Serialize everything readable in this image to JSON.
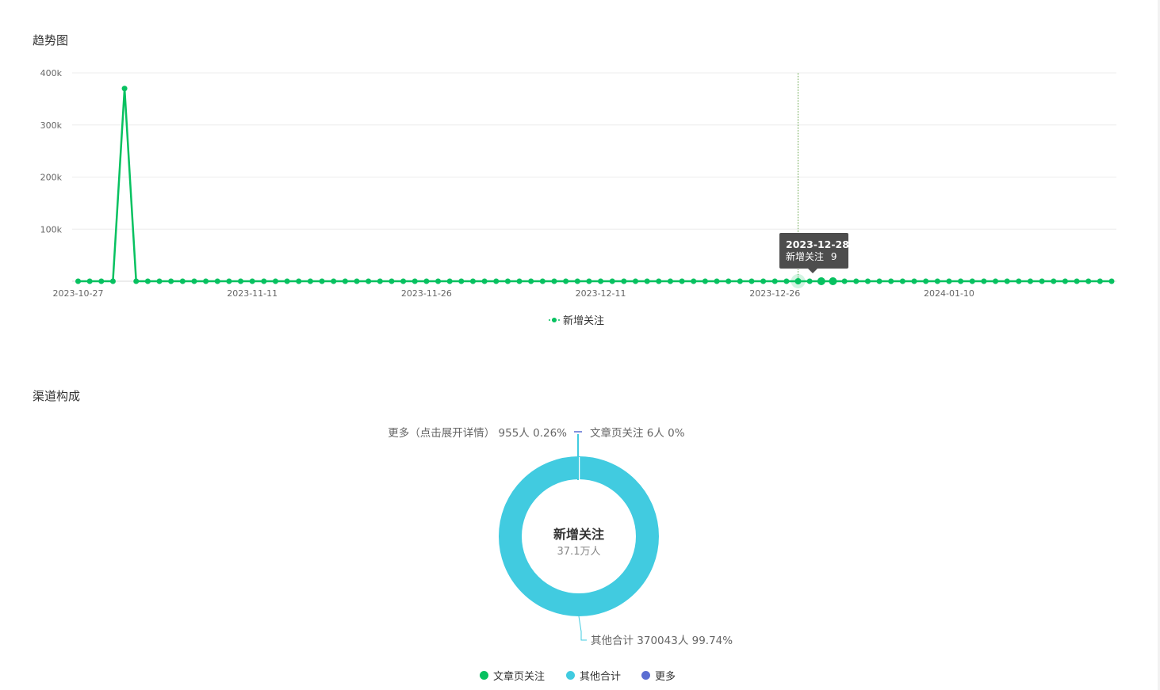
{
  "trend": {
    "title": "趋势图",
    "legend_label": "新增关注",
    "tooltip": {
      "date": "2023-12-28",
      "series": "新增关注",
      "value": "9"
    }
  },
  "channel": {
    "title": "渠道构成",
    "center_title": "新增关注",
    "center_value": "37.1万人",
    "labels": {
      "more": "更多（点击展开详情） 955人 0.26%",
      "article": "文章页关注 6人 0%",
      "other": "其他合计 370043人 99.74%"
    },
    "legend": [
      "文章页关注",
      "其他合计",
      "更多"
    ]
  },
  "colors": {
    "line": "#07c160",
    "other": "#41cbe0",
    "more": "#5b6ed2",
    "article": "#07c160",
    "grid": "#ececec"
  },
  "chart_data": [
    {
      "type": "line",
      "title": "趋势图",
      "start_date": "2023-10-27",
      "x_tick_labels": [
        "2023-10-27",
        "2023-11-11",
        "2023-11-26",
        "2023-12-11",
        "2023-12-26",
        "2024-01-10"
      ],
      "y_tick_labels": [
        "100k",
        "200k",
        "300k",
        "400k"
      ],
      "ylim": [
        0,
        400000
      ],
      "series": [
        {
          "name": "新增关注",
          "values": [
            3,
            4,
            2,
            3,
            370000,
            4,
            2,
            3,
            5,
            2,
            3,
            4,
            2,
            3,
            5,
            4,
            3,
            2,
            4,
            3,
            2,
            3,
            5,
            4,
            3,
            2,
            3,
            4,
            2,
            3,
            5,
            4,
            3,
            2,
            4,
            3,
            2,
            3,
            5,
            4,
            3,
            2,
            3,
            4,
            2,
            3,
            5,
            4,
            3,
            2,
            4,
            3,
            2,
            3,
            5,
            4,
            3,
            2,
            3,
            4,
            2,
            3,
            9,
            6,
            8,
            10,
            4,
            3,
            5,
            4,
            3,
            2,
            3,
            4,
            2,
            3,
            5,
            4,
            3,
            2,
            4,
            3,
            2,
            3,
            5,
            4,
            3,
            2,
            3,
            4
          ],
          "highlight_value": 9
        }
      ]
    },
    {
      "type": "pie",
      "title": "渠道构成",
      "slices": [
        {
          "name": "文章页关注",
          "value": 6,
          "percent": 0
        },
        {
          "name": "其他合计",
          "value": 370043,
          "percent": 99.74
        },
        {
          "name": "更多",
          "value": 955,
          "percent": 0.26
        }
      ],
      "total_label": "37.1万人"
    }
  ]
}
